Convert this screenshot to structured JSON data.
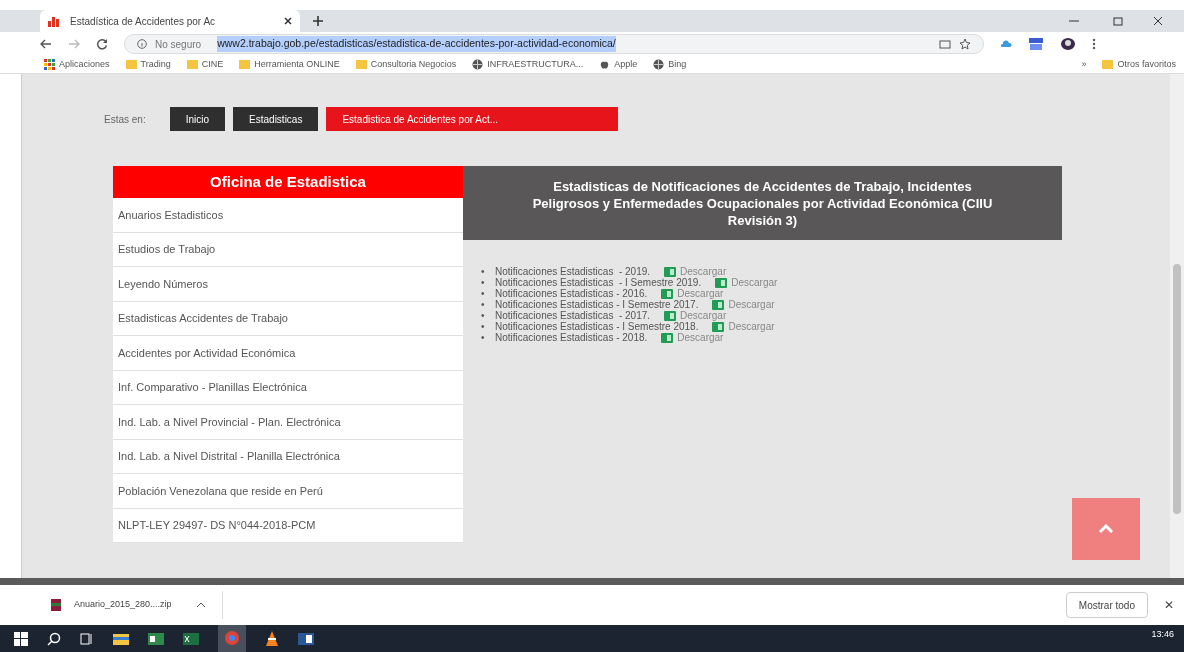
{
  "browser": {
    "tab_title": "Estadística de Accidentes por Ac",
    "security": "No seguro",
    "url": "www2.trabajo.gob.pe/estadisticas/estadistica-de-accidentes-por-actividad-economica/",
    "bookmarks": [
      {
        "label": "Aplicaciones",
        "kind": "apps"
      },
      {
        "label": "Trading",
        "kind": "folder"
      },
      {
        "label": "CINE",
        "kind": "folder"
      },
      {
        "label": "Herramienta ONLINE",
        "kind": "folder"
      },
      {
        "label": "Consultoria Negocios",
        "kind": "folder"
      },
      {
        "label": "INFRAESTRUCTURA...",
        "kind": "globe"
      },
      {
        "label": "Apple",
        "kind": "apple"
      },
      {
        "label": "Bing",
        "kind": "globe"
      }
    ],
    "more": "»",
    "other_bookmarks": "Otros favoritos"
  },
  "breadcrumb": {
    "label": "Estas en:",
    "items": [
      {
        "label": "Inicio",
        "selected": false
      },
      {
        "label": "Estadisticas",
        "selected": false
      },
      {
        "label": "Estadistica de Accidentes por Act...",
        "selected": true
      }
    ]
  },
  "sidebar": {
    "title": "Oficina de Estadistica",
    "items": [
      "Anuarios Estadisticos",
      "Estudios de Trabajo",
      "Leyendo Números",
      "Estadisticas Accidentes de Trabajo",
      "Accidentes por Actividad Económica",
      "Inf. Comparativo - Planillas Electrónica",
      "Ind. Lab. a Nivel Provincial - Plan. Electrónica",
      "Ind. Lab. a Nivel Distrital - Planilla Electrónica",
      "Población Venezolana que reside en Perú",
      "NLPT-LEY 29497- DS N°044-2018-PCM"
    ]
  },
  "content": {
    "title": "Estadisticas de Notificaciones de Accidentes de Trabajo, Incidentes Peligrosos y Enfermedades Ocupacionales por Actividad Económica (CIIU Revisión 3)",
    "items": [
      {
        "bullet": "•",
        "text": "Notificaciones Estadisticas  - 2019.",
        "link": "Descargar"
      },
      {
        "bullet": "•",
        "text": "Notificaciones Estadisticas  - I Semestre 2019.",
        "link": "Descargar"
      },
      {
        "bullet": "•",
        "text": "Notificaciones Estadisticas - 2016.",
        "link": "Descargar"
      },
      {
        "bullet": "•",
        "text": "Notificaciones Estadisticas - I Semestre 2017.",
        "link": "Descargar"
      },
      {
        "bullet": "•",
        "text": "Notificaciones Estadisticas  - 2017.",
        "link": "Descargar"
      },
      {
        "bullet": "•",
        "text": "Notificaciones Estadisticas - I Semestre 2018.",
        "link": "Descargar"
      },
      {
        "bullet": "•",
        "text": "Notificaciones Estadisticas - 2018.",
        "link": "Descargar"
      }
    ]
  },
  "downloads": {
    "file": "Anuario_2015_280....zip",
    "show_all": "Mostrar todo",
    "close": "✕"
  },
  "taskbar": {
    "time": "13:46"
  }
}
